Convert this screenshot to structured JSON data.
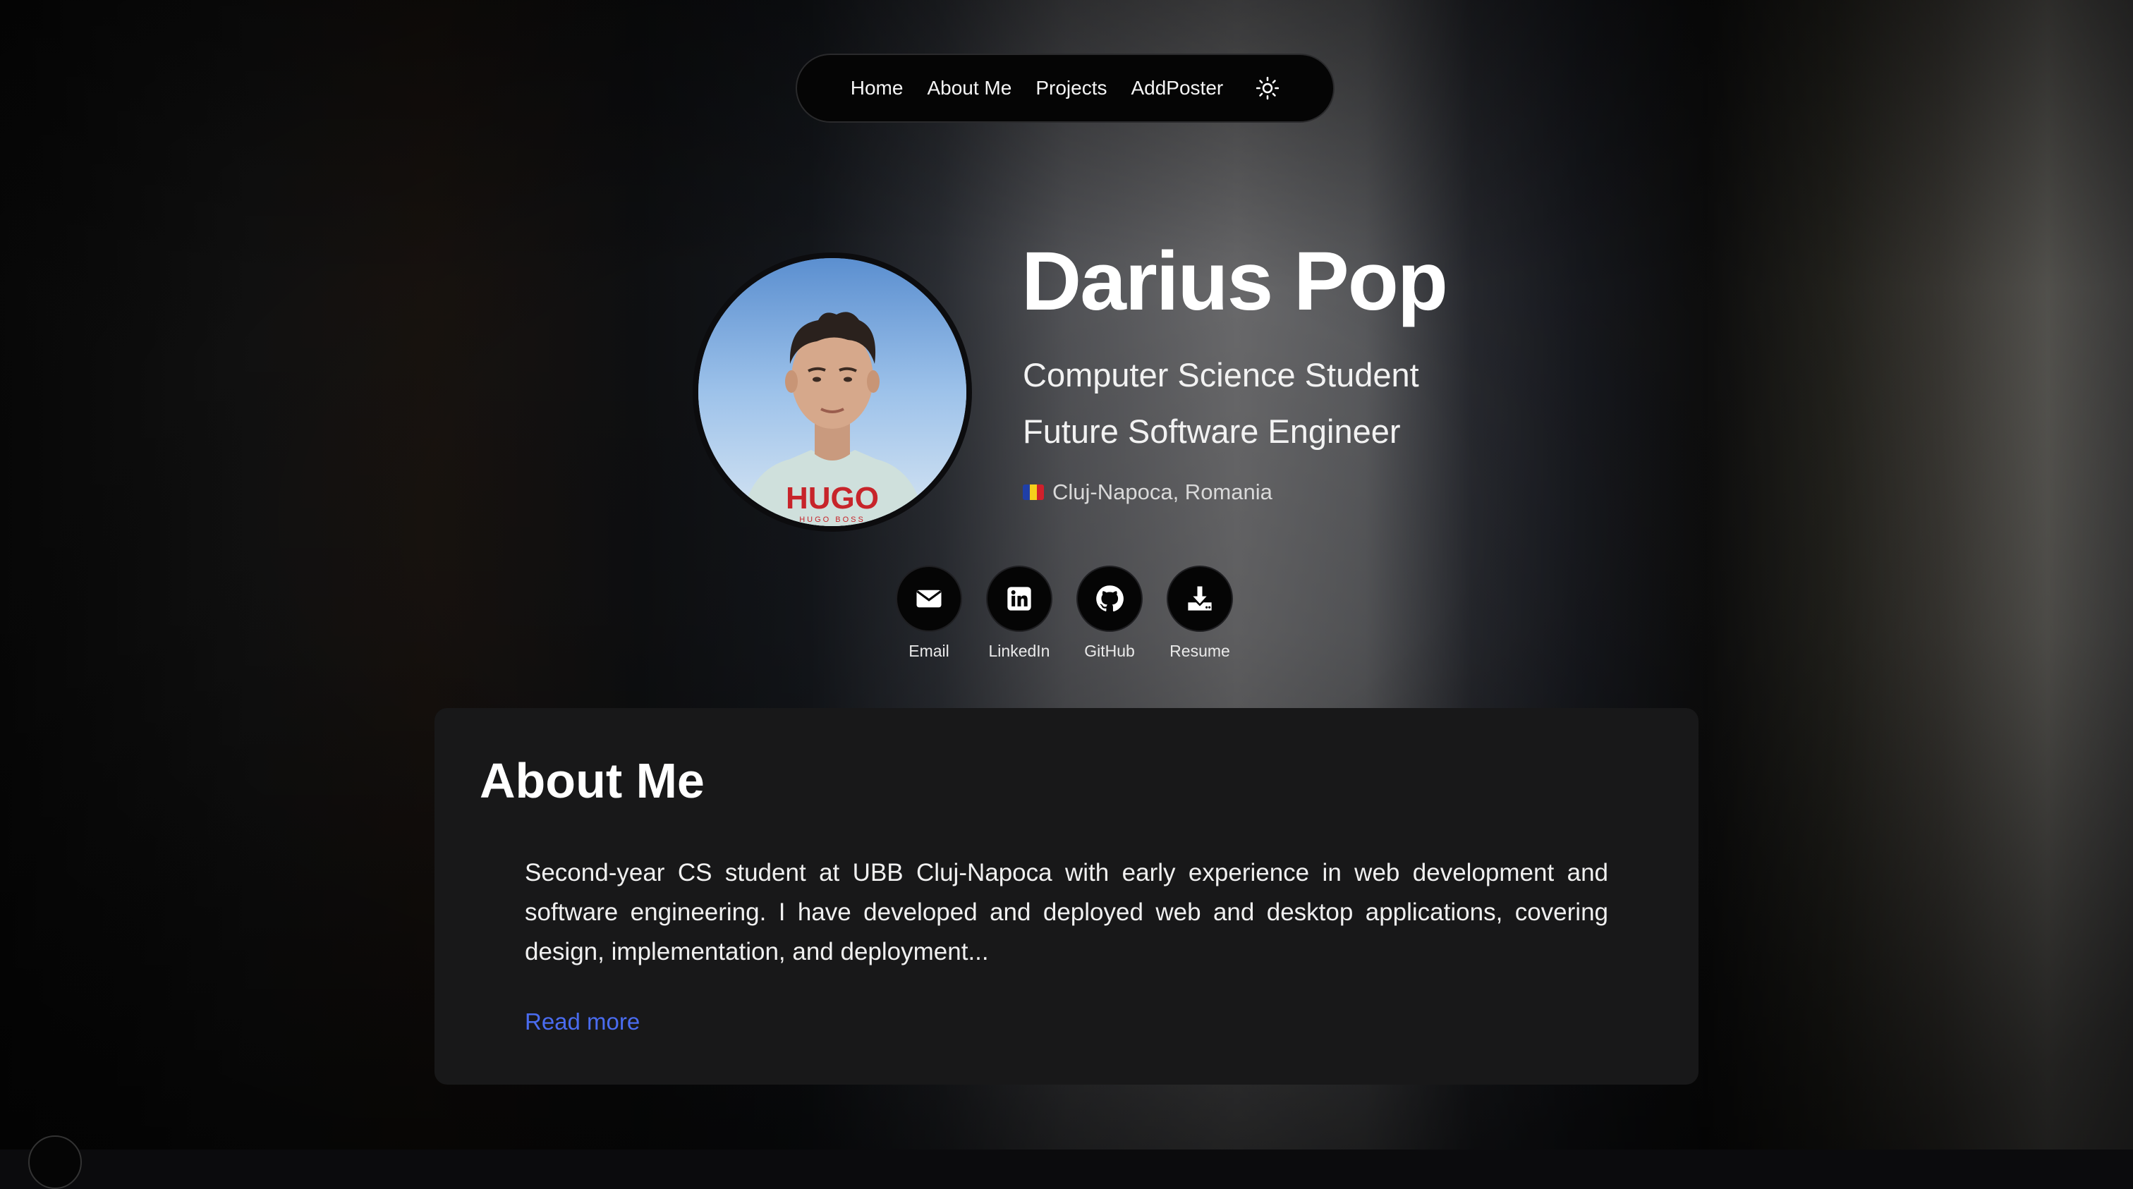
{
  "nav": {
    "items": [
      {
        "label": "Home"
      },
      {
        "label": "About Me"
      },
      {
        "label": "Projects"
      },
      {
        "label": "AddPoster"
      }
    ],
    "theme_icon": "sun-icon"
  },
  "hero": {
    "name": "Darius Pop",
    "subtitles": [
      "Computer Science Student",
      "Future Software Engineer"
    ],
    "location": "Cluj-Napoca, Romania",
    "flag_icon": "romania-flag-icon",
    "avatar_shirt_text": "HUGO",
    "avatar_shirt_subtext": "HUGO BOSS"
  },
  "social": [
    {
      "label": "Email",
      "icon": "envelope-icon"
    },
    {
      "label": "LinkedIn",
      "icon": "linkedin-icon"
    },
    {
      "label": "GitHub",
      "icon": "github-icon"
    },
    {
      "label": "Resume",
      "icon": "download-icon"
    }
  ],
  "about": {
    "title": "About Me",
    "text": "Second-year CS student at UBB Cluj-Napoca with early experience in web development and software engineering. I have developed and deployed web and desktop applications, covering design, implementation, and deployment...",
    "read_more": "Read more"
  },
  "colors": {
    "accent_link": "#4a6cf0",
    "card_bg": "#181819",
    "nav_bg": "#050505"
  }
}
